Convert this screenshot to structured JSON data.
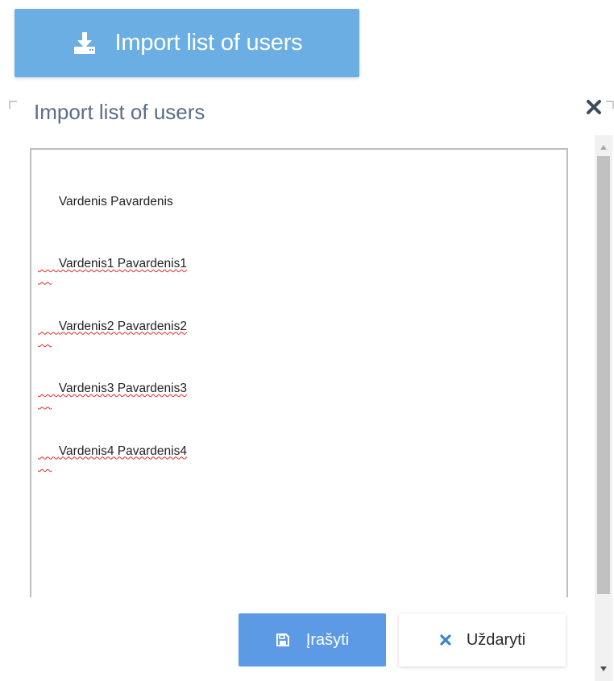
{
  "import_button": {
    "label": "Import list of users",
    "icon": "download-icon",
    "color": "#6aaee3"
  },
  "dialog": {
    "title": "Import list of users",
    "close_icon": "close-icon",
    "textarea": {
      "lines": [
        "Vardenis Pavardenis",
        "Vardenis1 Pavardenis1",
        "Vardenis2 Pavardenis2",
        "Vardenis3 Pavardenis3",
        "Vardenis4 Pavardenis4"
      ]
    },
    "buttons": {
      "save_label": "Įrašyti",
      "save_icon": "floppy-disk-icon",
      "save_color": "#5c9ae6",
      "close_label": "Uždaryti",
      "close_icon": "close-icon",
      "close_icon_color": "#3b82d6"
    }
  }
}
